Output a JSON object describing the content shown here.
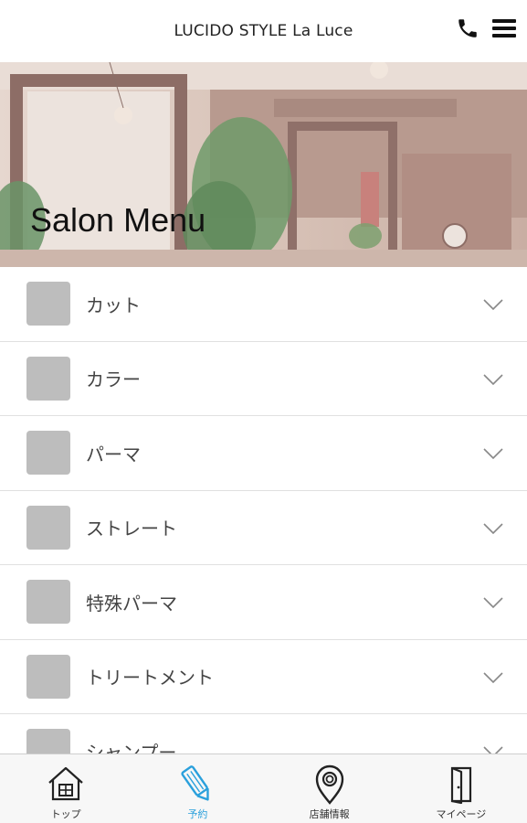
{
  "header": {
    "title": "LUCIDO STYLE La Luce",
    "icons": [
      "phone-icon",
      "hamburger-menu-icon"
    ]
  },
  "hero": {
    "title": "Salon Menu"
  },
  "menu": {
    "items": [
      {
        "label": "カット"
      },
      {
        "label": "カラー"
      },
      {
        "label": "パーマ"
      },
      {
        "label": "ストレート"
      },
      {
        "label": "特殊パーマ"
      },
      {
        "label": "トリートメント"
      },
      {
        "label": "シャンプー"
      }
    ]
  },
  "bottom_nav": {
    "items": [
      {
        "label": "トップ",
        "icon": "home-icon"
      },
      {
        "label": "予約",
        "icon": "pencil-icon",
        "active": true
      },
      {
        "label": "店舗情報",
        "icon": "map-pin-icon"
      },
      {
        "label": "マイページ",
        "icon": "door-icon"
      }
    ],
    "active_color": "#2aa0dc"
  }
}
